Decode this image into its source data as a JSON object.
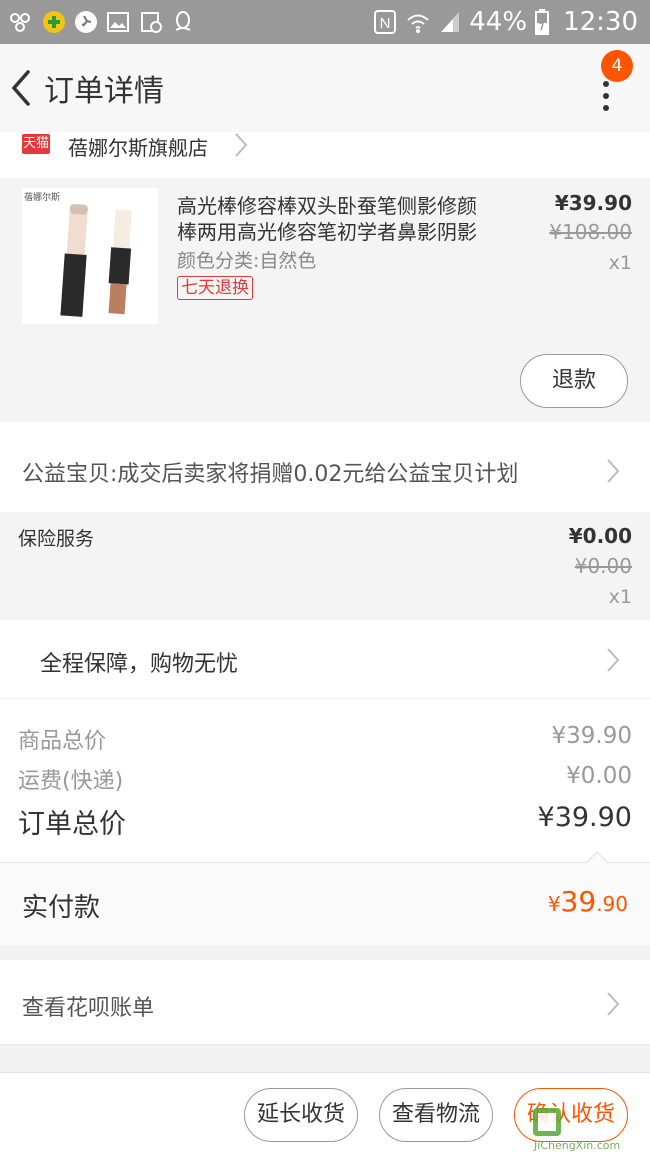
{
  "status_bar": {
    "battery": "44%",
    "time": "12:30"
  },
  "nav": {
    "title": "订单详情",
    "badge": "4"
  },
  "shop": {
    "tag": "天猫",
    "name": "蓓娜尔斯旗舰店"
  },
  "item": {
    "title_line1": "高光棒修容棒双头卧蚕笔侧影修颜",
    "title_line2": "棒两用高光修容笔初学者鼻影阴影",
    "sku": "颜色分类:自然色",
    "tag": "七天退换",
    "price": "¥39.90",
    "original_price": "¥108.00",
    "qty": "x1",
    "refund_button": "退款",
    "thumb_brand": "蓓娜尔斯"
  },
  "charity": {
    "text": "公益宝贝:成交后卖家将捐赠0.02元给公益宝贝计划"
  },
  "insurance": {
    "label": "保险服务",
    "price": "¥0.00",
    "original_price": "¥0.00",
    "qty": "x1"
  },
  "guarantee": {
    "text": "全程保障，购物无忧"
  },
  "summary": {
    "goods_label": "商品总价",
    "goods_value": "¥39.90",
    "shipping_label": "运费(快递)",
    "shipping_value": "¥0.00",
    "total_label": "订单总价",
    "total_value": "¥39.90"
  },
  "paid": {
    "label": "实付款",
    "currency": "¥",
    "integer": "39",
    "decimal": ".90"
  },
  "huabei": {
    "text": "查看花呗账单"
  },
  "actions": {
    "extend": "延长收货",
    "logistics": "查看物流",
    "confirm": "确认收货"
  },
  "watermark": {
    "text": "JiChengXin.com"
  },
  "colors": {
    "accent": "#ff5500",
    "tag_red": "#e4393c",
    "status_bar": "#999999"
  }
}
